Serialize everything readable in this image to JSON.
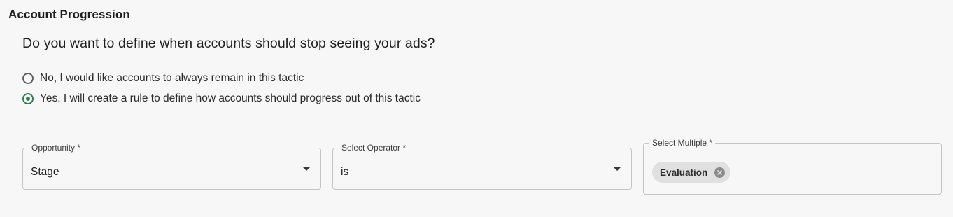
{
  "section": {
    "title": "Account Progression"
  },
  "question": "Do you want to define when accounts should stop seeing your ads?",
  "options": [
    {
      "label": "No, I would like accounts to always remain in this tactic",
      "selected": false
    },
    {
      "label": "Yes, I will create a rule to define how accounts should progress out of this tactic",
      "selected": true
    }
  ],
  "rule": {
    "opportunity": {
      "label": "Opportunity *",
      "value": "Stage"
    },
    "operator": {
      "label": "Select Operator *",
      "value": "is"
    },
    "multi": {
      "label": "Select Multiple *",
      "chips": [
        "Evaluation"
      ]
    }
  },
  "colors": {
    "accent": "#2e7d4f",
    "chip_bg": "#e0e0e0"
  },
  "icons": {
    "dropdown": "caret-down-icon",
    "chip_remove": "cancel-circle-icon"
  }
}
